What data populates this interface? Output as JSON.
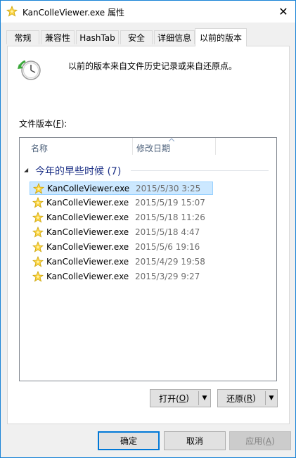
{
  "window": {
    "title": "KanColleViewer.exe 属性",
    "close_glyph": "✕"
  },
  "tabs": [
    {
      "label": "常规"
    },
    {
      "label": "兼容性"
    },
    {
      "label": "HashTab"
    },
    {
      "label": "安全"
    },
    {
      "label": "详细信息"
    },
    {
      "label": "以前的版本"
    }
  ],
  "active_tab": "以前的版本",
  "panel": {
    "info_text": "以前的版本来自文件历史记录或来自还原点。",
    "versions_label_pre": "文件版本(",
    "versions_label_key": "F",
    "versions_label_post": "):",
    "list": {
      "columns": {
        "name": "名称",
        "date": "修改日期"
      },
      "group": {
        "label": "今年的早些时候 (7)"
      },
      "rows": [
        {
          "name": "KanColleViewer.exe",
          "date": "2015/5/30 3:25",
          "selected": true
        },
        {
          "name": "KanColleViewer.exe",
          "date": "2015/5/19 15:07"
        },
        {
          "name": "KanColleViewer.exe",
          "date": "2015/5/18 11:26"
        },
        {
          "name": "KanColleViewer.exe",
          "date": "2015/5/18 4:47"
        },
        {
          "name": "KanColleViewer.exe",
          "date": "2015/5/6 19:16"
        },
        {
          "name": "KanColleViewer.exe",
          "date": "2015/4/29 19:58"
        },
        {
          "name": "KanColleViewer.exe",
          "date": "2015/3/29 9:27"
        }
      ]
    },
    "open_button": {
      "pre": "打开(",
      "key": "O",
      "post": ")"
    },
    "restore_button": {
      "pre": "还原(",
      "key": "R",
      "post": ")"
    }
  },
  "footer": {
    "ok": "确定",
    "cancel": "取消",
    "apply_pre": "应用(",
    "apply_key": "A",
    "apply_post": ")"
  },
  "colors": {
    "accent": "#0078d7",
    "selection": "#cce8ff",
    "group_text": "#1e3287"
  }
}
